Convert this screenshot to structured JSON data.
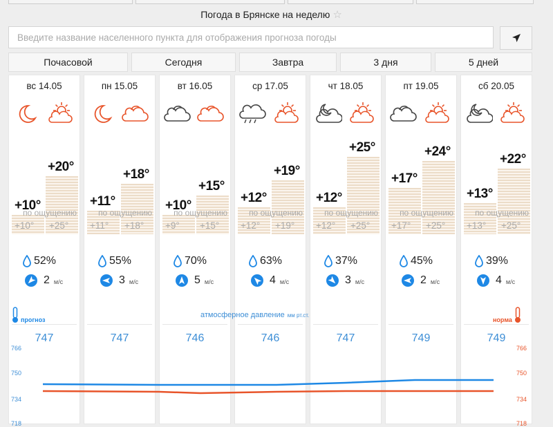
{
  "page_title": "Погода в Брянске на неделю",
  "search": {
    "placeholder": "Введите название населенного пункта для отображения прогноза погоды"
  },
  "tabs": [
    "Почасовой",
    "Сегодня",
    "Завтра",
    "3 дня",
    "5 дней"
  ],
  "feel_label": "по ощущению",
  "wind_unit": "м/с",
  "colors": {
    "forecast_line": "#1e88e5",
    "norm_line": "#e8542a",
    "bar": "#ecdcc8",
    "pressure_text": "#3d8ed6"
  },
  "days": [
    {
      "date": "вс 14.05",
      "night_icon": "moon-icon",
      "day_icon": "sun-cloud-icon",
      "t_night": "+10°",
      "t_day": "+20°",
      "feel_night": "+10°",
      "feel_day": "+25°",
      "humidity": "52%",
      "wind_speed": "2",
      "wind_dir": "wind-direction-icon",
      "pressure": "747"
    },
    {
      "date": "пн 15.05",
      "night_icon": "moon-icon",
      "day_icon": "cloud-icon",
      "t_night": "+11°",
      "t_day": "+18°",
      "feel_night": "+11°",
      "feel_day": "+18°",
      "humidity": "55%",
      "wind_speed": "3",
      "wind_dir": "wind-direction-icon",
      "pressure": "747"
    },
    {
      "date": "вт 16.05",
      "night_icon": "cloud-icon",
      "day_icon": "cloud-icon",
      "t_night": "+10°",
      "t_day": "+15°",
      "feel_night": "+9°",
      "feel_day": "+15°",
      "humidity": "70%",
      "wind_speed": "5",
      "wind_dir": "wind-direction-icon",
      "pressure": "746"
    },
    {
      "date": "ср 17.05",
      "night_icon": "rain-cloud-icon",
      "day_icon": "sun-cloud-icon",
      "t_night": "+12°",
      "t_day": "+19°",
      "feel_night": "+12°",
      "feel_day": "+19°",
      "humidity": "63%",
      "wind_speed": "4",
      "wind_dir": "wind-direction-icon",
      "pressure": "746"
    },
    {
      "date": "чт 18.05",
      "night_icon": "moon-cloud-icon",
      "day_icon": "sun-cloud-icon",
      "t_night": "+12°",
      "t_day": "+25°",
      "feel_night": "+12°",
      "feel_day": "+25°",
      "humidity": "37%",
      "wind_speed": "3",
      "wind_dir": "wind-direction-icon",
      "pressure": "747"
    },
    {
      "date": "пт 19.05",
      "night_icon": "cloud-icon",
      "day_icon": "sun-cloud-icon",
      "t_night": "+17°",
      "t_day": "+24°",
      "feel_night": "+17°",
      "feel_day": "+25°",
      "humidity": "45%",
      "wind_speed": "2",
      "wind_dir": "wind-direction-icon",
      "pressure": "749"
    },
    {
      "date": "сб 20.05",
      "night_icon": "moon-cloud-icon",
      "day_icon": "sun-cloud-icon",
      "t_night": "+13°",
      "t_day": "+22°",
      "feel_night": "+13°",
      "feel_day": "+25°",
      "humidity": "39%",
      "wind_speed": "4",
      "wind_dir": "wind-direction-icon",
      "pressure": "749"
    }
  ],
  "pressure": {
    "label_left": "прогноз",
    "label_right": "норма",
    "title": "атмосферное давление",
    "unit": "мм рт.ст.",
    "ticks": [
      "766",
      "750",
      "734",
      "718"
    ]
  }
}
